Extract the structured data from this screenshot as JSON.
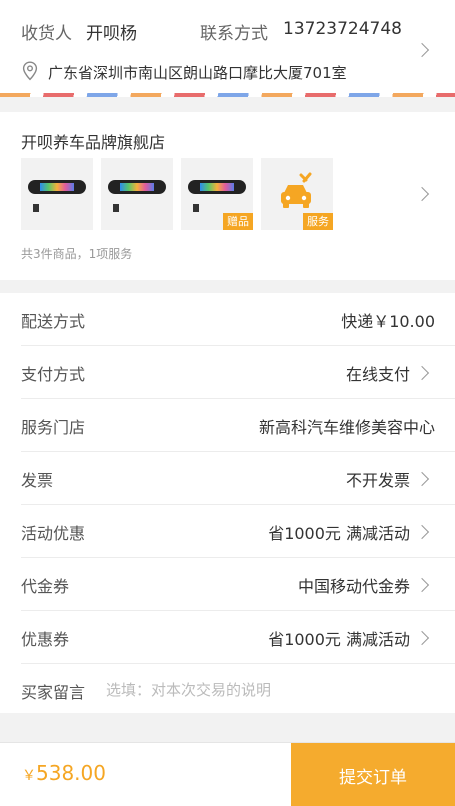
{
  "address": {
    "receiver_label": "收货人",
    "receiver_name": "开呗杨",
    "phone_label": "联系方式",
    "phone": "13723724748",
    "detail": "广东省深圳市南山区朗山路口摩比大厦701室",
    "stripe_colors": [
      "#f3a85e",
      "#e86c6c",
      "#7ea6e8"
    ]
  },
  "shop": {
    "name": "开呗养车品牌旗舰店",
    "thumbnails": [
      {
        "kind": "product",
        "badge": ""
      },
      {
        "kind": "product",
        "badge": ""
      },
      {
        "kind": "product",
        "badge": "赠品"
      },
      {
        "kind": "service",
        "badge": "服务",
        "icon": "car-repair-icon"
      }
    ],
    "summary": "共3件商品，1项服务"
  },
  "rows": [
    {
      "label": "配送方式",
      "value": "快递￥10.00"
    },
    {
      "label": "支付方式",
      "value": "在线支付"
    },
    {
      "label": "服务门店",
      "value": "新高科汽车维修美容中心"
    },
    {
      "label": "发票",
      "value": "不开发票"
    },
    {
      "label": "活动优惠",
      "value": "省1000元 满减活动"
    },
    {
      "label": "代金券",
      "value": "中国移动代金券"
    },
    {
      "label": "优惠券",
      "value": "省1000元 满减活动"
    }
  ],
  "remark": {
    "label": "买家留言",
    "placeholder": "选填：对本次交易的说明",
    "value": ""
  },
  "footer": {
    "currency": "￥",
    "total": "538.00",
    "submit_label": "提交订单"
  },
  "colors": {
    "accent": "#f5a623",
    "background": "#f2f2f2"
  }
}
